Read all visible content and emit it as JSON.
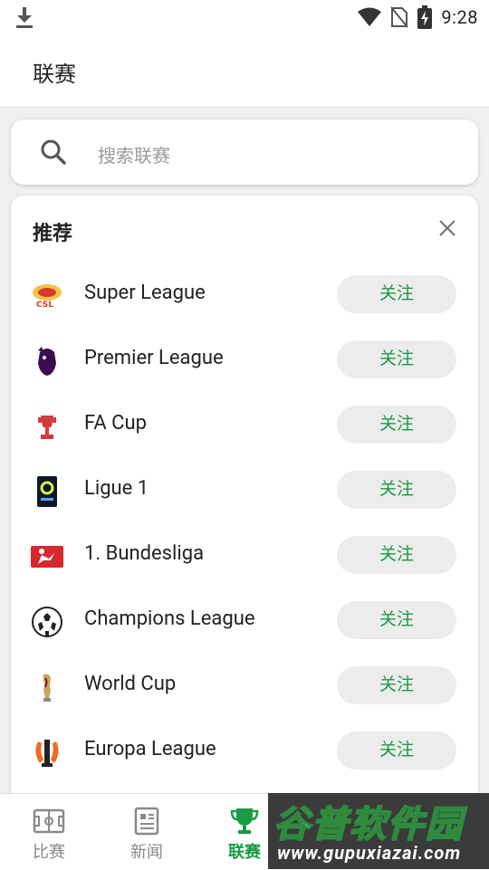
{
  "status_bar": {
    "time": "9:28"
  },
  "app_bar": {
    "title": "联赛"
  },
  "search": {
    "placeholder": "搜索联赛"
  },
  "recommend": {
    "heading": "推荐",
    "items": [
      {
        "name": "Super League",
        "follow_label": "关注",
        "logo": "csl-logo"
      },
      {
        "name": "Premier League",
        "follow_label": "关注",
        "logo": "premier-league-lion-logo"
      },
      {
        "name": "FA Cup",
        "follow_label": "关注",
        "logo": "fa-cup-trophy-logo"
      },
      {
        "name": "Ligue 1",
        "follow_label": "关注",
        "logo": "ligue1-logo"
      },
      {
        "name": "1. Bundesliga",
        "follow_label": "关注",
        "logo": "bundesliga-logo"
      },
      {
        "name": "Champions League",
        "follow_label": "关注",
        "logo": "champions-league-ball-logo"
      },
      {
        "name": "World Cup",
        "follow_label": "关注",
        "logo": "world-cup-trophy-logo"
      },
      {
        "name": "Europa League",
        "follow_label": "关注",
        "logo": "europa-league-trophy-logo"
      }
    ]
  },
  "bottom_nav": {
    "tabs": [
      {
        "label": "比赛",
        "icon": "pitch-icon"
      },
      {
        "label": "新闻",
        "icon": "news-icon"
      },
      {
        "label": "联赛",
        "icon": "trophy-icon"
      }
    ],
    "active_index": 2
  },
  "watermark": {
    "title": "谷普软件园",
    "url": "www.gupuxiazai.com"
  },
  "colors": {
    "accent": "#1a9a45",
    "follow_bg": "#ececec"
  }
}
